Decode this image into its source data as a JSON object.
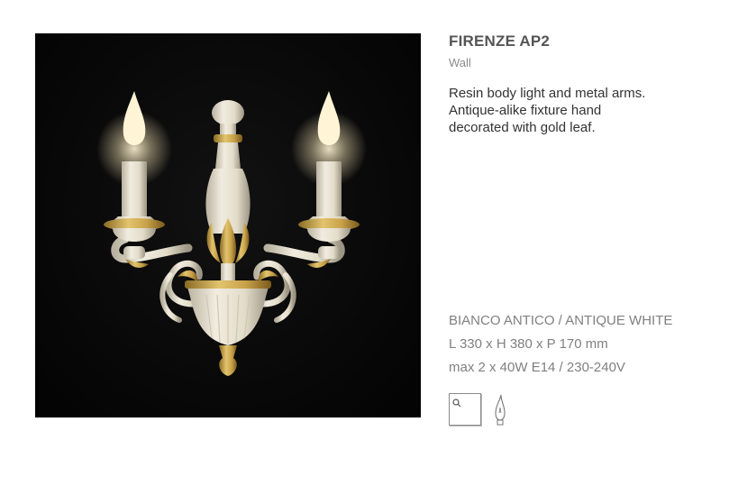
{
  "product": {
    "title": "FIRENZE AP2",
    "category": "Wall",
    "description_lines": [
      "Resin body light and metal arms.",
      "Antique-alike fixture hand",
      "decorated with gold leaf."
    ],
    "finish": "BIANCO ANTICO / ANTIQUE WHITE",
    "dimensions": "L 330 x H 380 x P 170 mm",
    "lamp_spec": "max 2 x 40W E14 / 230-240V"
  },
  "icons": [
    "wall-mount-icon",
    "candle-bulb-icon"
  ],
  "colors": {
    "title": "#555555",
    "body_text": "#333333",
    "spec_text": "#808080",
    "photo_background": "#0a0a0a",
    "fixture_ivory": "#ece6d4",
    "gold_leaf": "#c7a24a"
  }
}
